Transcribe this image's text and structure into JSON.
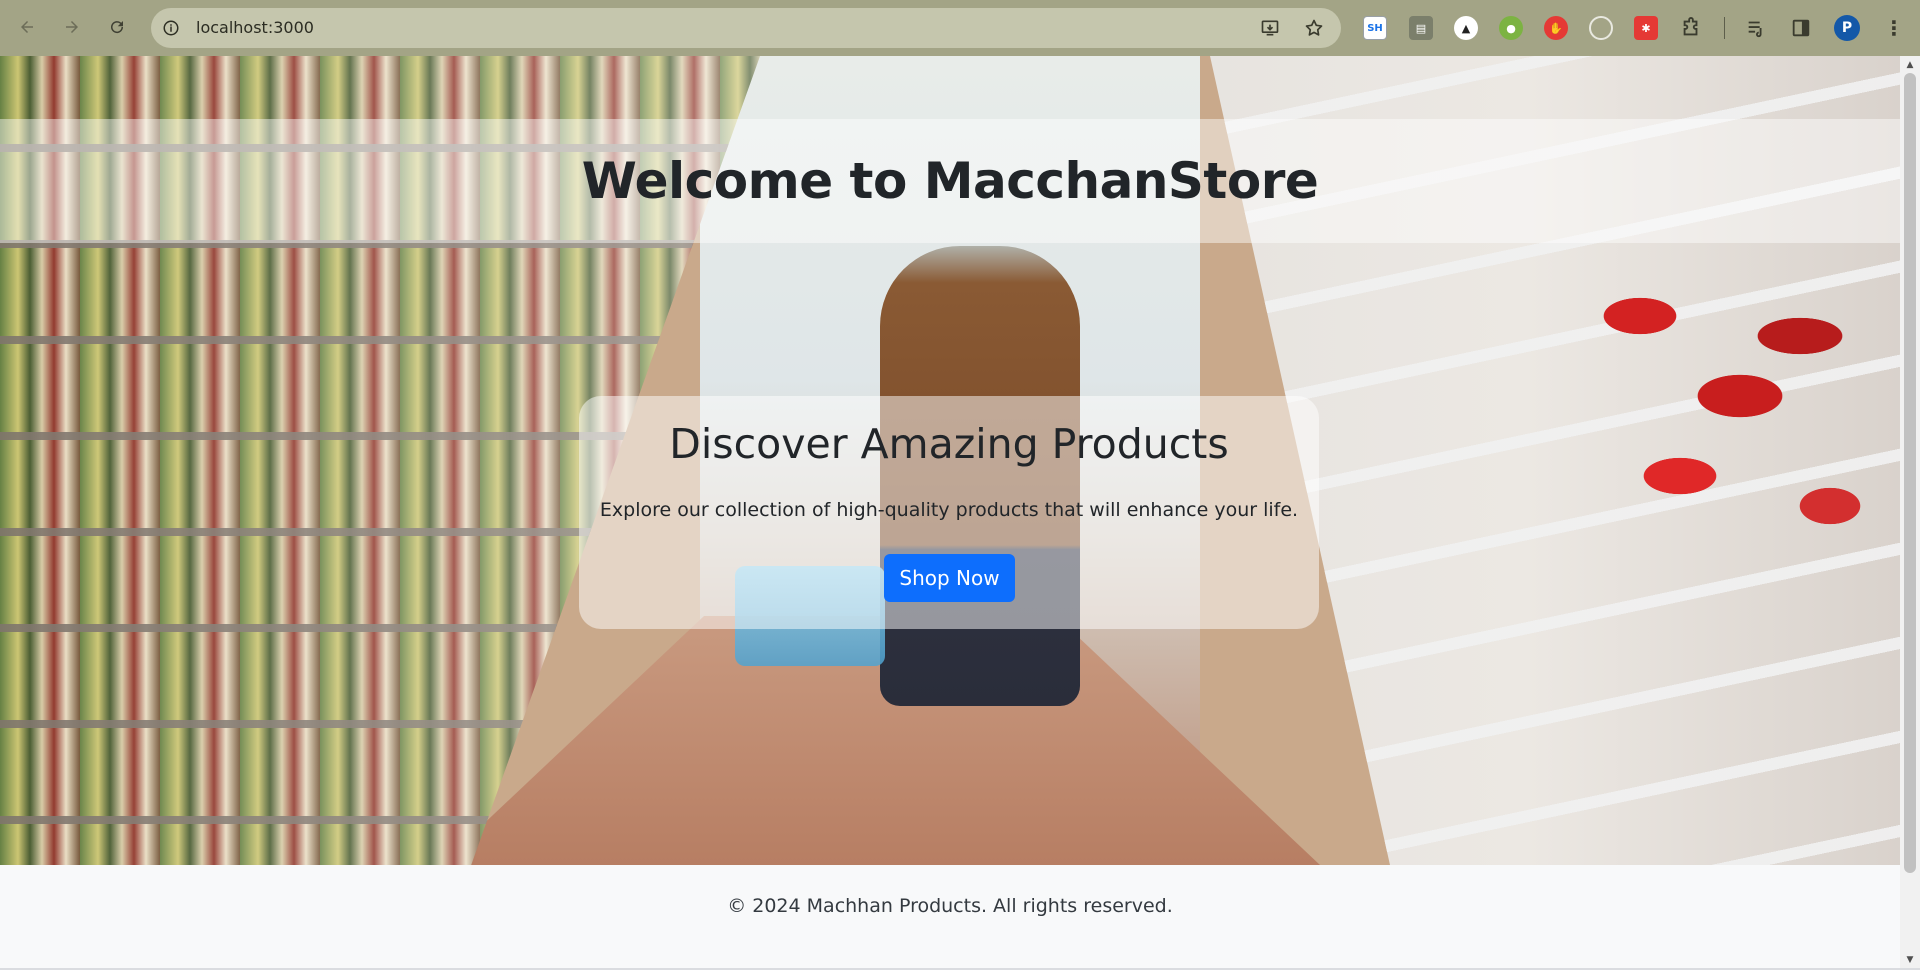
{
  "browser": {
    "url": "localhost:3000",
    "profile_initial": "P",
    "extensions": [
      {
        "name": "sh-icon",
        "label": "SH"
      }
    ],
    "menu_glyph": "⋮"
  },
  "page": {
    "welcome_title": "Welcome to MacchanStore",
    "promo": {
      "title": "Discover Amazing Products",
      "text": "Explore our collection of high-quality products that will enhance your life.",
      "button_label": "Shop Now"
    },
    "footer_text": "© 2024 Machhan Products. All rights reserved."
  },
  "colors": {
    "chrome_bg": "#a3a486",
    "omnibox_bg": "#c5c6ad",
    "primary_button": "#0d6efd",
    "footer_bg": "#f8f9fa",
    "text_dark": "#212529"
  }
}
